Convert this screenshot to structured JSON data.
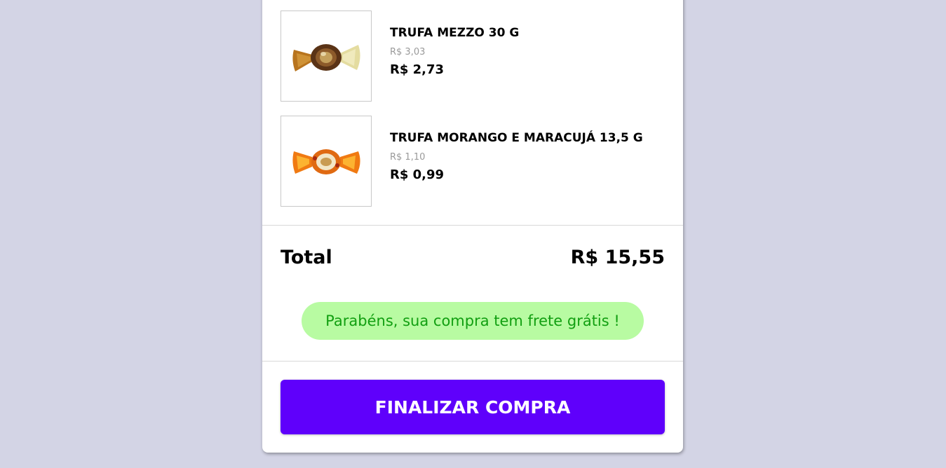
{
  "cart": {
    "items": [
      {
        "name": "TRUFA MEZZO 30 G",
        "old_price": "R$ 3,03",
        "price": "R$ 2,73",
        "image_icon": "truffle-candy-brown-icon"
      },
      {
        "name": "TRUFA MORANGO E MARACUJÁ 13,5 G",
        "old_price": "R$ 1,10",
        "price": "R$ 0,99",
        "image_icon": "truffle-candy-orange-icon"
      }
    ],
    "total_label": "Total",
    "total_value": "R$ 15,55",
    "free_shipping_message": "Parabéns, sua compra tem frete grátis !",
    "checkout_label": "FINALIZAR COMPRA"
  },
  "colors": {
    "background": "#d3d4e5",
    "card": "#ffffff",
    "free_shipping_bg": "#b8fba2",
    "free_shipping_text": "#119f11",
    "checkout_bg": "#5f00fb",
    "checkout_text": "#ffffff"
  }
}
